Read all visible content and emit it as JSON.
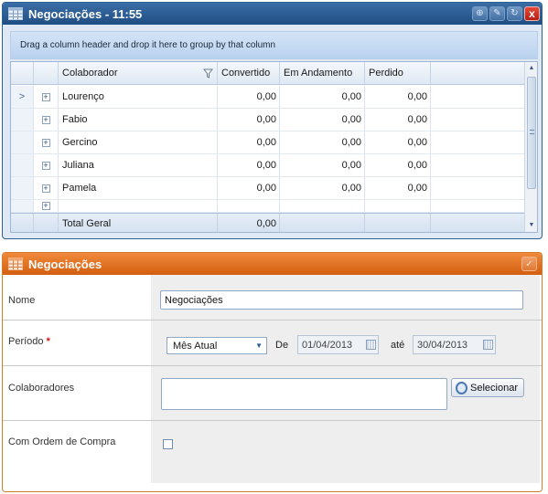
{
  "grid_window": {
    "title": "Negociações - 11:55",
    "group_hint": "Drag a column header and drop it here to group by that column",
    "columns": [
      "Colaborador",
      "Convertido",
      "Em Andamento",
      "Perdido"
    ],
    "rows": [
      {
        "name": "Lourenço",
        "convertido": "0,00",
        "andamento": "0,00",
        "perdido": "0,00",
        "current": true
      },
      {
        "name": "Fabio",
        "convertido": "0,00",
        "andamento": "0,00",
        "perdido": "0,00"
      },
      {
        "name": "Gercino",
        "convertido": "0,00",
        "andamento": "0,00",
        "perdido": "0,00"
      },
      {
        "name": "Juliana",
        "convertido": "0,00",
        "andamento": "0,00",
        "perdido": "0,00"
      },
      {
        "name": "Pamela",
        "convertido": "0,00",
        "andamento": "0,00",
        "perdido": "0,00"
      }
    ],
    "total": {
      "label": "Total Geral",
      "convertido": "0,00"
    }
  },
  "form_window": {
    "title": "Negociações",
    "nome_label": "Nome",
    "nome_value": "Negociações",
    "periodo_label": "Período",
    "required_mark": "*",
    "periodo_select": "Mês Atual",
    "de_label": "De",
    "date_from": "01/04/2013",
    "ate_label": "até",
    "date_to": "30/04/2013",
    "colaboradores_label": "Colaboradores",
    "colaboradores_value": "",
    "selecionar_label": "Selecionar",
    "ordem_label": "Com Ordem de Compra",
    "ordem_checked": false
  },
  "colors": {
    "grid_title": "#2f5f96",
    "form_title": "#e46f22",
    "close_button": "#c9301f"
  },
  "icons": [
    "grid-icon",
    "add-icon",
    "edit-icon",
    "refresh-icon",
    "close-icon",
    "filter-icon",
    "expand-icon",
    "row-indicator-icon",
    "check-icon",
    "search-icon",
    "calendar-icon"
  ]
}
